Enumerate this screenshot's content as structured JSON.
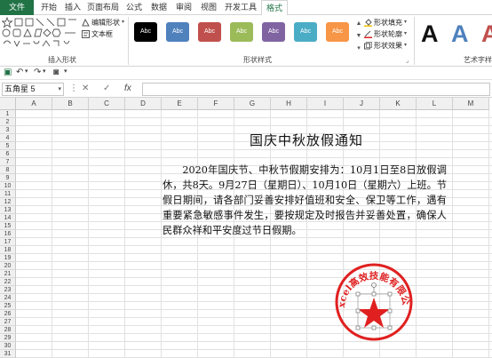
{
  "tabs": [
    {
      "label": "文件",
      "active": false
    },
    {
      "label": "开始",
      "active": false
    },
    {
      "label": "插入",
      "active": false
    },
    {
      "label": "页面布局",
      "active": false
    },
    {
      "label": "公式",
      "active": false
    },
    {
      "label": "数据",
      "active": false
    },
    {
      "label": "审阅",
      "active": false
    },
    {
      "label": "视图",
      "active": false
    },
    {
      "label": "开发工具",
      "active": false
    },
    {
      "label": "格式",
      "active": true
    }
  ],
  "ribbon": {
    "insert_shapes": {
      "label": "插入形状",
      "edit_shape": "编辑形状",
      "textbox": "文本框"
    },
    "shape_styles": {
      "label": "形状样式",
      "buttons": [
        {
          "text": "Abc",
          "color": "#000000"
        },
        {
          "text": "Abc",
          "color": "#4f81bd"
        },
        {
          "text": "Abc",
          "color": "#c0504d"
        },
        {
          "text": "Abc",
          "color": "#9bbb59"
        },
        {
          "text": "Abc",
          "color": "#8064a2"
        },
        {
          "text": "Abc",
          "color": "#4bacc6"
        },
        {
          "text": "Abc",
          "color": "#f79646"
        }
      ],
      "fill": "形状填充",
      "outline": "形状轮廓",
      "effects": "形状效果"
    },
    "wordart": {
      "label": "艺术字样",
      "samples": [
        {
          "text": "A",
          "color": "#111111"
        },
        {
          "text": "A",
          "color": "#4f81bd"
        },
        {
          "text": "A",
          "color": "#c0504d"
        }
      ]
    }
  },
  "formula_bar": {
    "name_box": "五角星 5",
    "formula": ""
  },
  "columns": [
    "A",
    "B",
    "C",
    "D",
    "E",
    "F",
    "G",
    "H",
    "I",
    "J",
    "K",
    "L",
    "M"
  ],
  "rows": [
    "1",
    "2",
    "3",
    "4",
    "5",
    "6",
    "7",
    "8",
    "9",
    "10",
    "11",
    "12",
    "13",
    "14",
    "15",
    "16",
    "17",
    "18",
    "19",
    "20",
    "21",
    "22",
    "23",
    "24",
    "25",
    "26",
    "27",
    "28",
    "29",
    "30",
    "31"
  ],
  "notice": {
    "title": "国庆中秋放假通知",
    "body": "2020年国庆节、中秋节假期安排为：10月1日至8日放假调休，共8天。9月27日（星期日）、10月10日（星期六）上班。节假日期间，请各部门妥善安排好值班和安全、保卫等工作，遇有重要紧急敏感事件发生，要按规定及时报告并妥善处置，确保人民群众祥和平安度过节日假期。"
  },
  "seal": {
    "text": "Excel高效技能有限公司",
    "color": "#e02020"
  }
}
